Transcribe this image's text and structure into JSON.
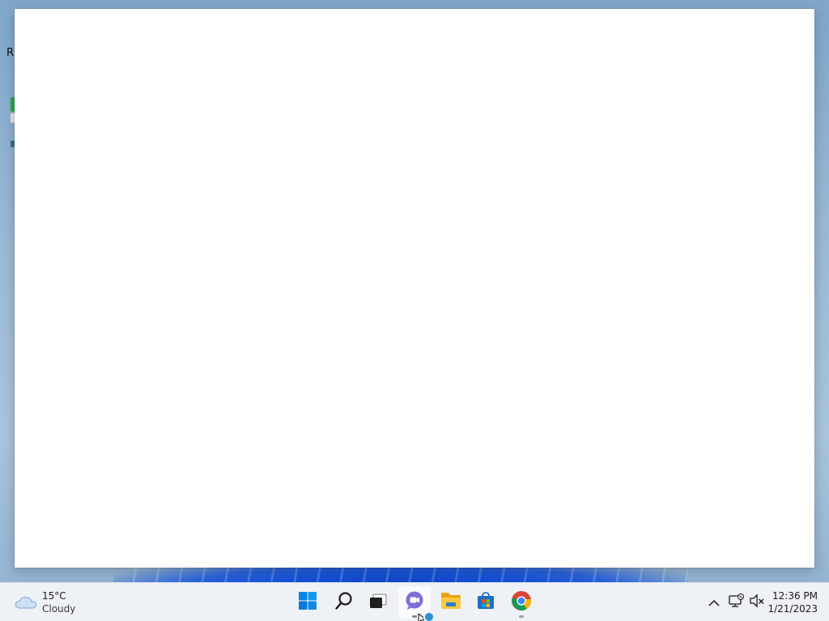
{
  "desktop": {
    "partial_label": "R"
  },
  "window": {
    "content": ""
  },
  "taskbar": {
    "weather": {
      "temperature": "15°C",
      "condition": "Cloudy",
      "icon": "cloud-icon"
    },
    "apps": [
      {
        "name": "Start",
        "icon": "windows-start-icon"
      },
      {
        "name": "Search",
        "icon": "search-icon"
      },
      {
        "name": "Task View",
        "icon": "task-view-icon"
      },
      {
        "name": "Chat",
        "icon": "teams-chat-icon"
      },
      {
        "name": "File Explorer",
        "icon": "folder-icon"
      },
      {
        "name": "Microsoft Store",
        "icon": "store-icon"
      },
      {
        "name": "Google Chrome",
        "icon": "chrome-icon"
      }
    ],
    "tray": {
      "time": "12:36 PM",
      "date": "1/21/2023"
    }
  },
  "colors": {
    "accent": "#0078d4",
    "taskbar_bg": "#eef1f6"
  }
}
